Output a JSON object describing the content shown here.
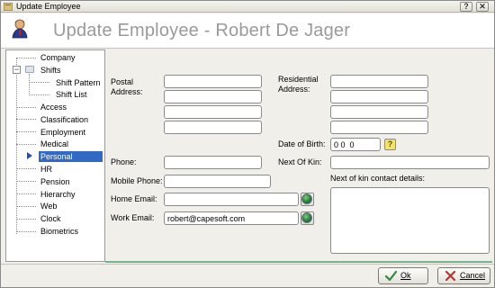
{
  "window": {
    "title": "Update Employee",
    "help_button": "?",
    "close_button": "✕"
  },
  "header": {
    "title": "Update Employee - Robert De Jager"
  },
  "tree": {
    "items": [
      {
        "label": "Company"
      },
      {
        "label": "Shifts",
        "expander": "−"
      },
      {
        "label": "Shift Pattern"
      },
      {
        "label": "Shift List"
      },
      {
        "label": "Access"
      },
      {
        "label": "Classification"
      },
      {
        "label": "Employment"
      },
      {
        "label": "Medical"
      },
      {
        "label": "Personal",
        "selected": true
      },
      {
        "label": "HR"
      },
      {
        "label": "Pension"
      },
      {
        "label": "Hierarchy"
      },
      {
        "label": "Web"
      },
      {
        "label": "Clock"
      },
      {
        "label": "Biometrics"
      }
    ]
  },
  "form": {
    "postal_address_label": "Postal Address:",
    "postal_address_lines": [
      "",
      "",
      "",
      ""
    ],
    "residential_address_label": "Residential Address:",
    "residential_address_lines": [
      "",
      "",
      "",
      ""
    ],
    "date_of_birth_label": "Date of Birth:",
    "date_of_birth_value": "0 0  0",
    "help_icon_text": "?",
    "phone_label": "Phone:",
    "phone_value": "",
    "next_of_kin_label": "Next Of Kin:",
    "next_of_kin_value": "",
    "mobile_phone_label": "Mobile Phone:",
    "mobile_phone_value": "",
    "next_of_kin_contact_label": "Next of kin contact details:",
    "next_of_kin_contact_value": "",
    "home_email_label": "Home Email:",
    "home_email_value": "",
    "work_email_label": "Work Email:",
    "work_email_value": "robert@capesoft.com"
  },
  "buttons": {
    "ok_label": "Ok",
    "cancel_label": "Cancel"
  },
  "colors": {
    "selection": "#316ac5",
    "accent_band": "#77b38b"
  }
}
